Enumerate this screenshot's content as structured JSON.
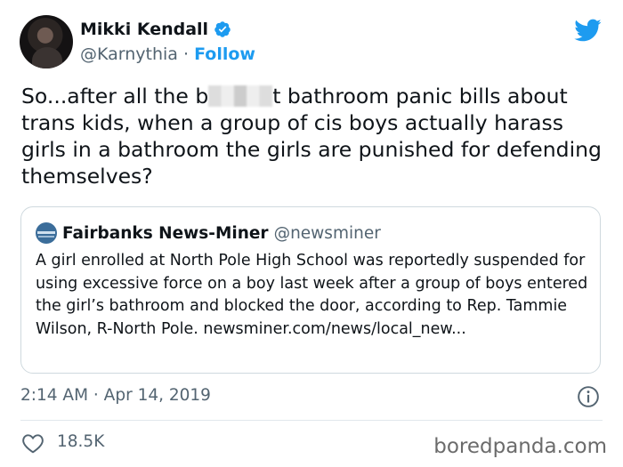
{
  "author": {
    "name": "Mikki Kendall",
    "handle": "@Karnythia",
    "separator": "·",
    "follow_label": "Follow"
  },
  "tweet": {
    "text_before": "So...after all the b",
    "redacted_fragment": "[redacted]",
    "text_after": "t bathroom panic bills about trans kids, when a group of cis boys actually harass girls in a bathroom the girls are punished for defending themselves?"
  },
  "quoted": {
    "name": "Fairbanks News-Miner",
    "handle": "@newsminer",
    "text": "A girl enrolled at North Pole High School was reportedly suspended for using excessive force on a boy last week after a group of boys entered the girl’s bathroom and blocked the door, according to Rep. Tammie Wilson, R-North Pole. newsminer.com/news/local_new..."
  },
  "meta": {
    "timestamp": "2:14 AM · Apr 14, 2019",
    "like_count": "18.5K"
  },
  "watermark": "boredpanda.com",
  "colors": {
    "accent": "#1d9bf0",
    "text": "#0f1419",
    "muted": "#536471",
    "border": "#cfd9de"
  },
  "icons": {
    "brand": "twitter-bird-icon",
    "verified": "verified-badge-icon",
    "info": "info-icon",
    "like": "heart-icon"
  }
}
